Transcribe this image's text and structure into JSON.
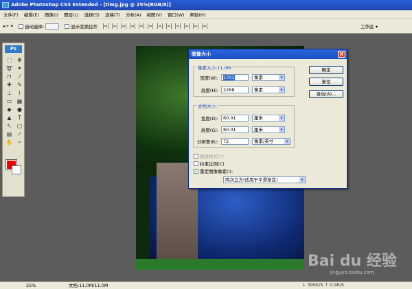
{
  "app": {
    "title": "Adobe Photoshop CS3 Extended - [timg.jpg @ 25%(RGB/8)]"
  },
  "menubar": [
    "文件(F)",
    "编辑(E)",
    "图像(I)",
    "图层(L)",
    "选择(S)",
    "滤镜(T)",
    "分析(A)",
    "视图(V)",
    "窗口(W)",
    "帮助(H)"
  ],
  "options": {
    "auto_select_label": "自动选择:",
    "show_transform_label": "显示变换控件",
    "workspace_label": "工作区 ▾"
  },
  "toolbox": {
    "logo": "Ps"
  },
  "dialog": {
    "title": "图像大小",
    "close": "X",
    "pixel_section": "像素大小:11.0M",
    "width_label": "宽度(W):",
    "width_value": "1701",
    "width_unit": "像素",
    "height_label": "高度(H):",
    "height_value": "2268",
    "height_unit": "像素",
    "doc_section": "文档大小:",
    "doc_width_label": "宽度(D):",
    "doc_width_value": "60.01",
    "doc_width_unit": "厘米",
    "doc_height_label": "高度(G):",
    "doc_height_value": "80.01",
    "doc_height_unit": "厘米",
    "res_label": "分辨率(R):",
    "res_value": "72",
    "res_unit": "像素/英寸",
    "scale_styles": "缩放样式(Y)",
    "constrain": "约束比例(C)",
    "resample": "重定图像像素(I):",
    "resample_method": "两次立方(适用于平滑渐变)",
    "ok": "确定",
    "reset": "复位",
    "auto": "自动(A)..."
  },
  "status": {
    "zoom": "25%",
    "doc": "文档:11.0M/11.0M"
  },
  "network": {
    "down": "399K/S",
    "up": "0.9K/S"
  },
  "watermark": {
    "brand": "Bai du 经验",
    "url": "jingyan.baidu.com"
  }
}
